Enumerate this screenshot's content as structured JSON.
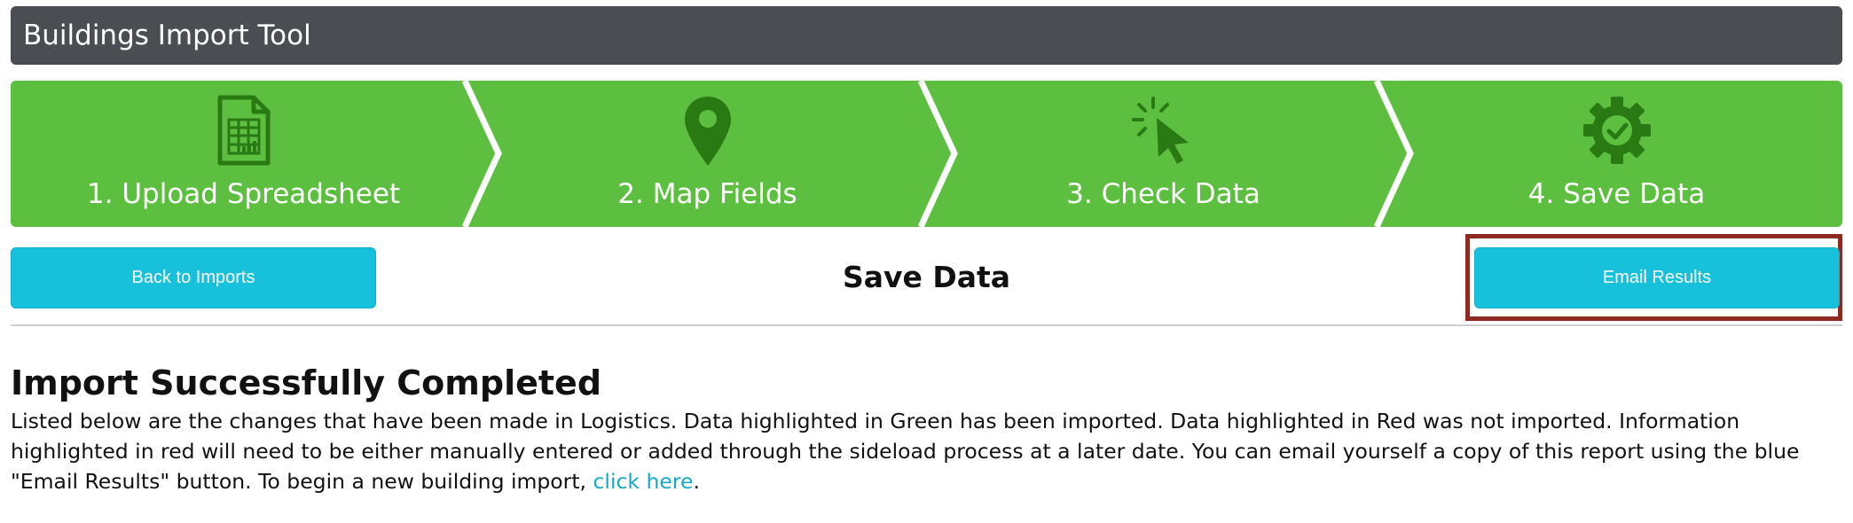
{
  "header": {
    "title": "Buildings Import Tool"
  },
  "wizard": {
    "colors": {
      "step": "#5cbf3f",
      "icon": "#2a7a14",
      "text": "#ffffff"
    },
    "steps": [
      {
        "label": "1. Upload Spreadsheet",
        "icon": "spreadsheet-icon"
      },
      {
        "label": "2. Map Fields",
        "icon": "map-pin-icon"
      },
      {
        "label": "3. Check Data",
        "icon": "cursor-click-icon"
      },
      {
        "label": "4. Save Data",
        "icon": "gear-check-icon"
      }
    ]
  },
  "toolbar": {
    "back_label": "Back to Imports",
    "title": "Save Data",
    "email_label": "Email Results",
    "button_color": "#17c1dc",
    "highlight_color": "#8e2a22"
  },
  "result": {
    "heading": "Import Successfully Completed",
    "text_before_link": "Listed below are the changes that have been made in Logistics. Data highlighted in Green has been imported. Data highlighted in Red was not imported. Information highlighted in red will need to be either manually entered or added through the sideload process at a later date. You can email yourself a copy of this report using the blue \"Email Results\" button. To begin a new building import, ",
    "link_label": "click here",
    "text_after_link": "."
  }
}
